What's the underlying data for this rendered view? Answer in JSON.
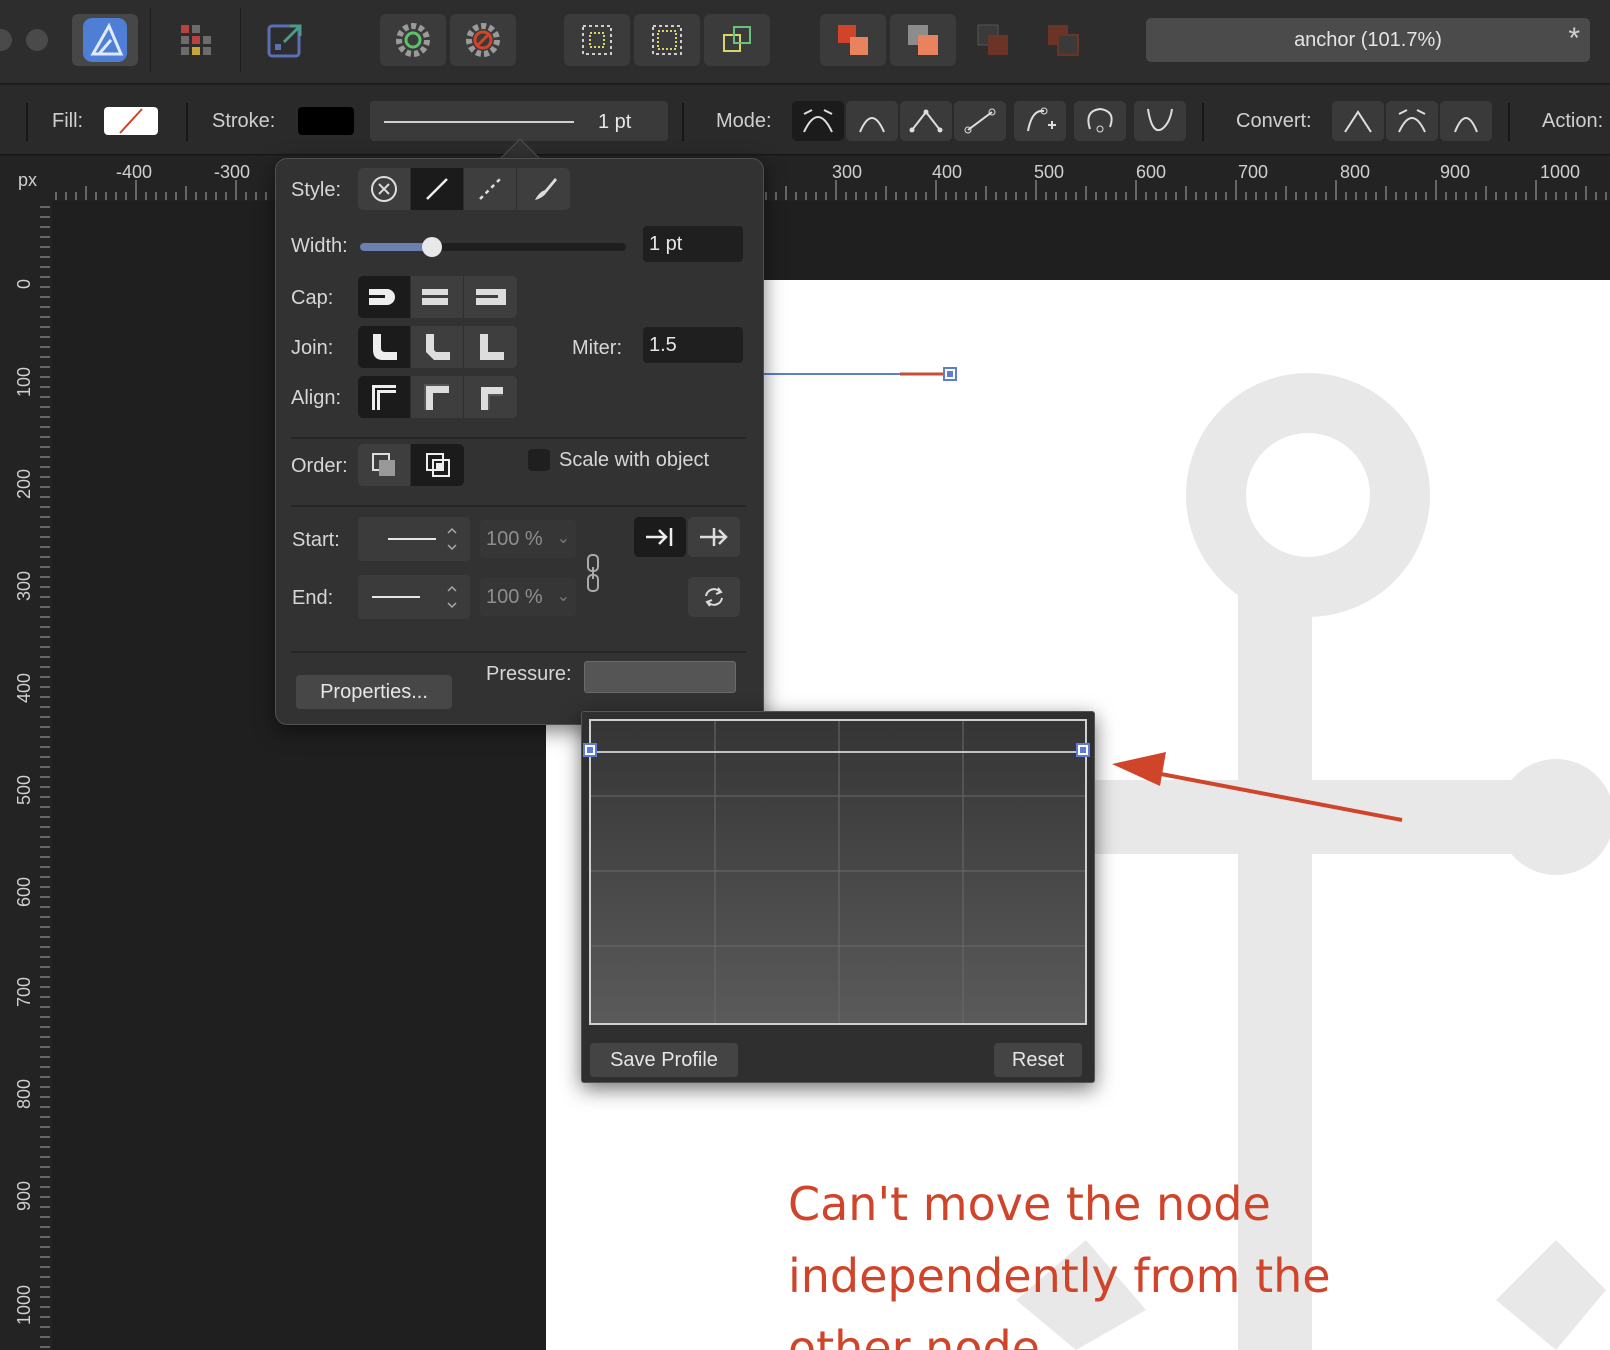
{
  "window": {
    "title": "anchor (101.7%)",
    "modified_mark": "*"
  },
  "toolbar": {
    "app_icon": "designer-persona-icon",
    "items": [
      "pixel-persona-icon",
      "export-persona-icon",
      "snapping-settings-icon",
      "snapping-off-icon",
      "marquee-select-icon",
      "marquee-select-all-icon",
      "transform-origin-icon",
      "boolean-add-icon",
      "boolean-subtract-icon",
      "boolean-intersect-icon",
      "boolean-xor-icon"
    ]
  },
  "context_bar": {
    "fill_label": "Fill:",
    "stroke_label": "Stroke:",
    "stroke_width": "1 pt",
    "mode_label": "Mode:",
    "convert_label": "Convert:",
    "action_label": "Action:",
    "stroke_color": "#000000",
    "fill_color": "none"
  },
  "rulers": {
    "unit": "px",
    "h_labels": [
      "-400",
      "-300",
      "300",
      "400",
      "500",
      "600",
      "700",
      "800",
      "900",
      "1000"
    ],
    "v_labels": [
      "0",
      "100",
      "200",
      "300",
      "400",
      "500",
      "600",
      "700",
      "800",
      "900",
      "1000"
    ]
  },
  "stroke_panel": {
    "style_label": "Style:",
    "width_label": "Width:",
    "width_value": "1 pt",
    "width_slider_fraction": 0.24,
    "cap_label": "Cap:",
    "join_label": "Join:",
    "miter_label": "Miter:",
    "miter_value": "1.5",
    "align_label": "Align:",
    "order_label": "Order:",
    "scale_with_object_label": "Scale with object",
    "scale_with_object": false,
    "start_label": "Start:",
    "end_label": "End:",
    "start_pct": "100 %",
    "end_pct": "100 %",
    "properties_button": "Properties...",
    "pressure_label": "Pressure:"
  },
  "pressure_popup": {
    "save_profile_button": "Save Profile",
    "reset_button": "Reset"
  },
  "annotation": {
    "lines": [
      "Can't move the node",
      "independently from the",
      "other node"
    ],
    "color": "#d0452a"
  },
  "colors": {
    "accent": "#5d7cd6",
    "panel_bg": "#323232",
    "canvas_bg": "#1f1f1f"
  }
}
